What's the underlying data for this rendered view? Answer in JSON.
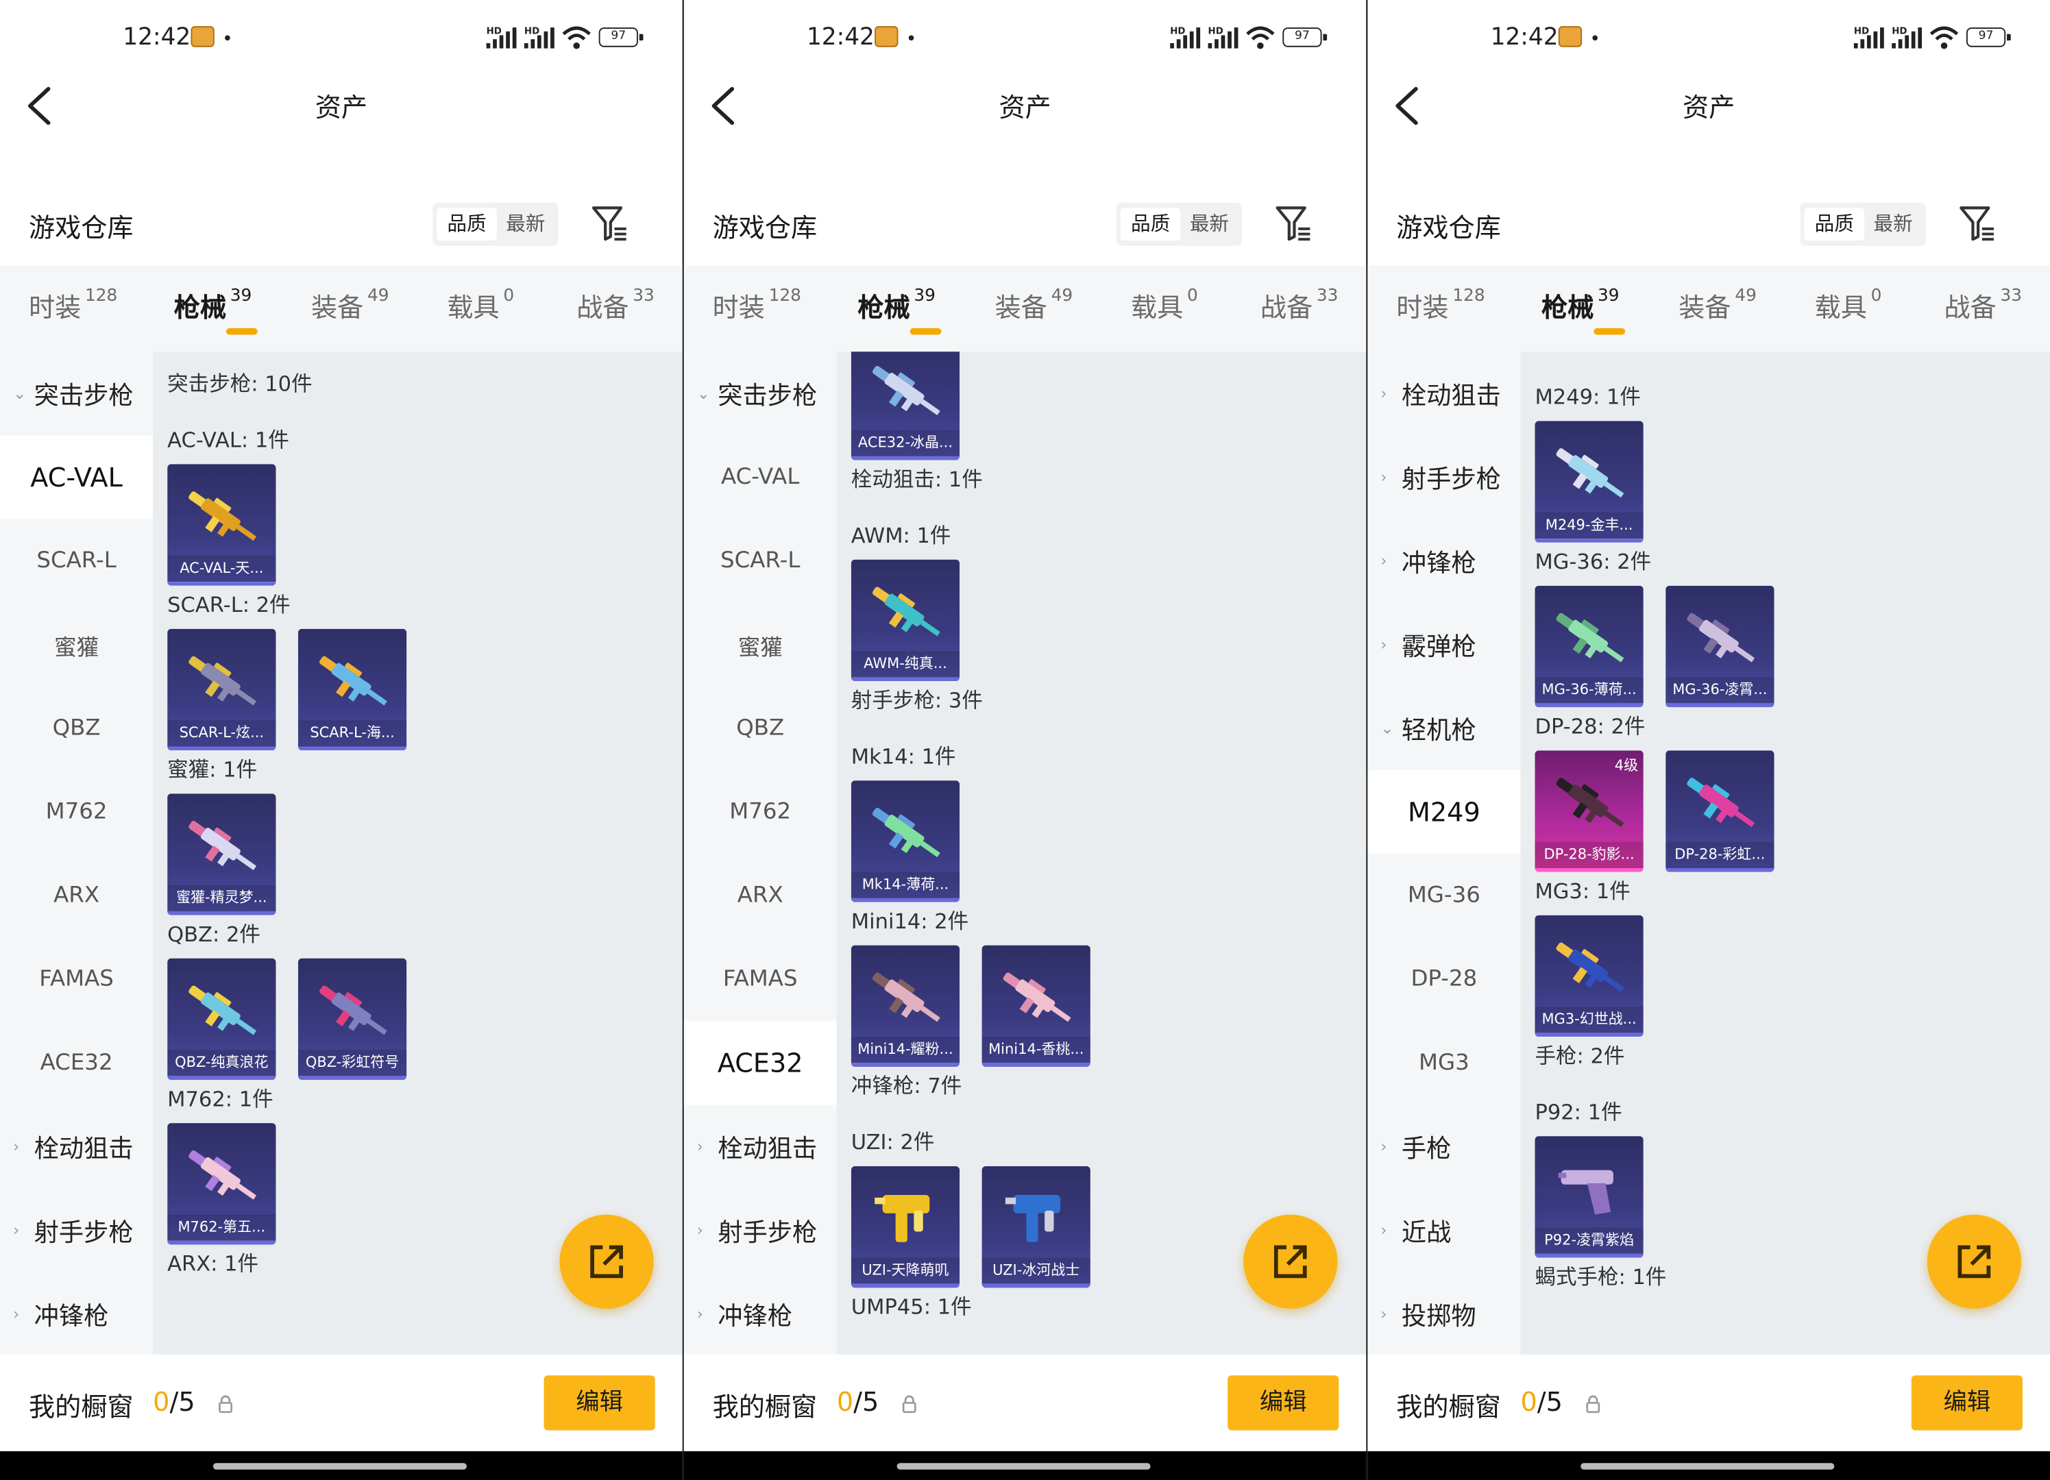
{
  "status": {
    "time": "12:42",
    "hd": "HD",
    "battery": "97"
  },
  "header": {
    "title": "资产"
  },
  "warehouse": {
    "title": "游戏仓库",
    "sort_quality": "品质",
    "sort_latest": "最新"
  },
  "categories": [
    {
      "label": "时装",
      "count": "128"
    },
    {
      "label": "枪械",
      "count": "39"
    },
    {
      "label": "装备",
      "count": "49"
    },
    {
      "label": "载具",
      "count": "0"
    },
    {
      "label": "战备",
      "count": "33"
    }
  ],
  "bottom": {
    "title": "我的橱窗",
    "used": "0",
    "total": "/5",
    "edit": "编辑"
  },
  "panels": [
    {
      "sidebar": [
        {
          "label": "突击步枪",
          "group": true,
          "chev": "⌄",
          "expanded": true
        },
        {
          "label": "AC-VAL",
          "selected": true
        },
        {
          "label": "SCAR-L"
        },
        {
          "label": "蜜獾"
        },
        {
          "label": "QBZ"
        },
        {
          "label": "M762"
        },
        {
          "label": "ARX"
        },
        {
          "label": "FAMAS"
        },
        {
          "label": "ACE32"
        },
        {
          "label": "栓动狙击",
          "group": true,
          "chev": "›"
        },
        {
          "label": "射手步枪",
          "group": true,
          "chev": "›"
        },
        {
          "label": "冲锋枪",
          "group": true,
          "chev": "›"
        }
      ],
      "content": [
        {
          "label": "突击步枪: 10件"
        },
        {
          "label": "AC-VAL: 1件",
          "items": [
            {
              "name": "AC-VAL-天...",
              "color": "#e0a020",
              "accent": "#f5d04a"
            }
          ]
        },
        {
          "label": "SCAR-L: 2件",
          "items": [
            {
              "name": "SCAR-L-炫...",
              "color": "#8a8ab0",
              "accent": "#e0c040"
            },
            {
              "name": "SCAR-L-海...",
              "color": "#6ab8e8",
              "accent": "#f0b030"
            }
          ]
        },
        {
          "label": "蜜獾: 1件",
          "items": [
            {
              "name": "蜜獾-精灵梦...",
              "color": "#d8d8f0",
              "accent": "#e070a0"
            }
          ]
        },
        {
          "label": "QBZ: 2件",
          "items": [
            {
              "name": "QBZ-纯真浪花",
              "color": "#70c8e0",
              "accent": "#f0d040"
            },
            {
              "name": "QBZ-彩虹符号",
              "color": "#8080c0",
              "accent": "#e04080"
            }
          ]
        },
        {
          "label": "M762: 1件",
          "items": [
            {
              "name": "M762-第五...",
              "color": "#f0c8d8",
              "accent": "#b080e0"
            }
          ]
        },
        {
          "label": "ARX: 1件"
        }
      ]
    },
    {
      "sidebar": [
        {
          "label": "突击步枪",
          "group": true,
          "chev": "⌄",
          "expanded": true
        },
        {
          "label": "AC-VAL"
        },
        {
          "label": "SCAR-L"
        },
        {
          "label": "蜜獾"
        },
        {
          "label": "QBZ"
        },
        {
          "label": "M762"
        },
        {
          "label": "ARX"
        },
        {
          "label": "FAMAS"
        },
        {
          "label": "ACE32",
          "selected": true
        },
        {
          "label": "栓动狙击",
          "group": true,
          "chev": "›"
        },
        {
          "label": "射手步枪",
          "group": true,
          "chev": "›"
        },
        {
          "label": "冲锋枪",
          "group": true,
          "chev": "›"
        }
      ],
      "content": [
        {
          "items": [
            {
              "name": "ACE32-冰晶...",
              "color": "#d0d8f0",
              "accent": "#80b0e0"
            }
          ]
        },
        {
          "label": "栓动狙击: 1件"
        },
        {
          "label": "AWM: 1件",
          "items": [
            {
              "name": "AWM-纯真...",
              "color": "#40c0c8",
              "accent": "#f0c040"
            }
          ]
        },
        {
          "label": "射手步枪: 3件"
        },
        {
          "label": "Mk14: 1件",
          "items": [
            {
              "name": "Mk14-薄荷...",
              "color": "#80e0a0",
              "accent": "#60a0e0"
            }
          ]
        },
        {
          "label": "Mini14: 2件",
          "items": [
            {
              "name": "Mini14-耀粉...",
              "color": "#e0b0c0",
              "accent": "#806060"
            },
            {
              "name": "Mini14-香桃...",
              "color": "#f0c0d0",
              "accent": "#e090b0"
            }
          ]
        },
        {
          "label": "冲锋枪: 7件"
        },
        {
          "label": "UZI: 2件",
          "items": [
            {
              "name": "UZI-天降萌叽",
              "color": "#f0c020",
              "accent": "#f8e070",
              "short": true
            },
            {
              "name": "UZI-冰河战士",
              "color": "#3070d0",
              "accent": "#d0d0e0",
              "short": true
            }
          ]
        },
        {
          "label": "UMP45: 1件"
        }
      ]
    },
    {
      "sidebar": [
        {
          "label": "栓动狙击",
          "group": true,
          "chev": "›"
        },
        {
          "label": "射手步枪",
          "group": true,
          "chev": "›"
        },
        {
          "label": "冲锋枪",
          "group": true,
          "chev": "›"
        },
        {
          "label": "霰弹枪",
          "group": true,
          "chev": "›"
        },
        {
          "label": "轻机枪",
          "group": true,
          "chev": "⌄",
          "expanded": true
        },
        {
          "label": "M249",
          "selected": true
        },
        {
          "label": "MG-36"
        },
        {
          "label": "DP-28"
        },
        {
          "label": "MG3"
        },
        {
          "label": "手枪",
          "group": true,
          "chev": "›"
        },
        {
          "label": "近战",
          "group": true,
          "chev": "›"
        },
        {
          "label": "投掷物",
          "group": true,
          "chev": "›"
        }
      ],
      "content": [
        {
          "label": "M249: 1件",
          "items": [
            {
              "name": "M249-金丰...",
              "color": "#a0d8f0",
              "accent": "#e0e0f0"
            }
          ]
        },
        {
          "label": "MG-36: 2件",
          "items": [
            {
              "name": "MG-36-薄荷...",
              "color": "#90e0b0",
              "accent": "#60b080"
            },
            {
              "name": "MG-36-凌霄...",
              "color": "#d0c0e0",
              "accent": "#8070a0"
            }
          ]
        },
        {
          "label": "DP-28: 2件",
          "items": [
            {
              "name": "DP-28-豹影...",
              "color": "#503040",
              "accent": "#202020",
              "level": "4级",
              "pink": true
            },
            {
              "name": "DP-28-彩虹...",
              "color": "#e040a0",
              "accent": "#40c0e0"
            }
          ]
        },
        {
          "label": "MG3: 1件",
          "items": [
            {
              "name": "MG3-幻世战...",
              "color": "#3050c0",
              "accent": "#f0c040"
            }
          ]
        },
        {
          "label": "手枪: 2件"
        },
        {
          "label": "P92: 1件",
          "items": [
            {
              "name": "P92-凌霄紫焰",
              "color": "#c8b0e0",
              "accent": "#9070c0",
              "pistol": true
            }
          ]
        },
        {
          "label": "蝎式手枪: 1件"
        }
      ]
    }
  ]
}
